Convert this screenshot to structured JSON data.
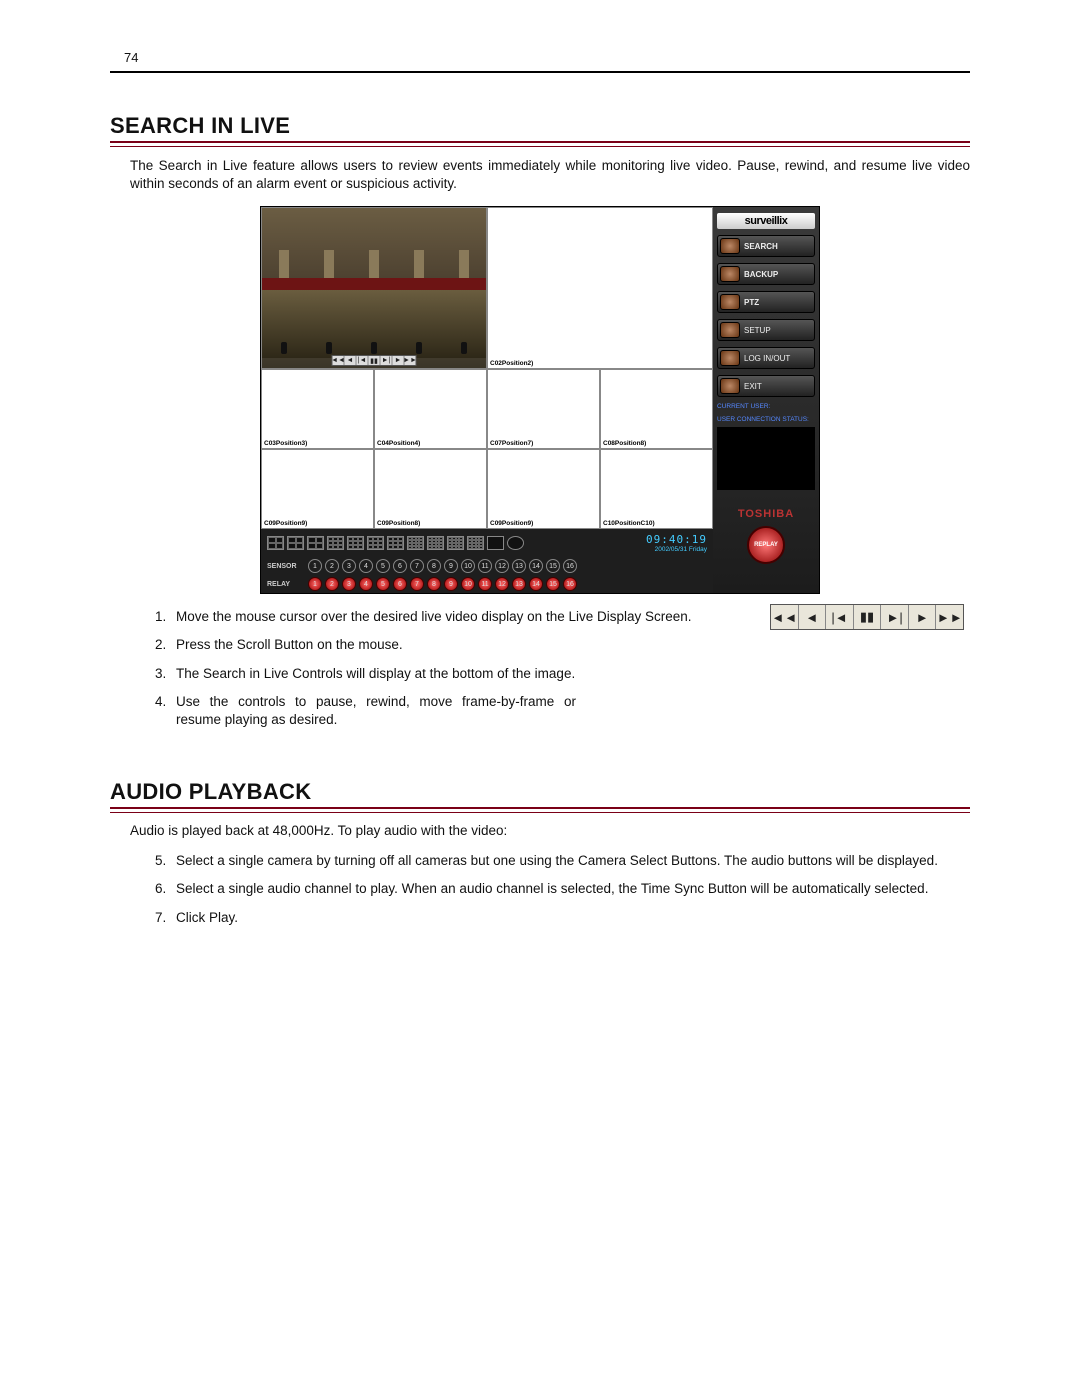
{
  "page_number": "74",
  "sections": {
    "search": {
      "title": "SEARCH IN LIVE",
      "lead": "The Search in Live feature allows users to review events immediately while monitoring live video.  Pause, rewind, and resume live video within seconds of an alarm event or suspicious activity.",
      "steps": [
        "Move the mouse cursor over the desired live video display on the Live Display Screen.",
        "Press the Scroll Button on the mouse.",
        "The Search in Live Controls will display at the bottom of the image.",
        "Use the controls to pause, rewind, move frame-by-frame or resume playing as desired."
      ]
    },
    "audio": {
      "title": "AUDIO PLAYBACK",
      "intro": "Audio is played back at 48,000Hz.  To play audio with the video:",
      "steps": [
        "Select a single camera by turning off all cameras but one using the Camera Select Buttons.  The audio buttons will be displayed.",
        "Select a single audio channel to play.  When an audio channel is selected, the Time Sync Button will be automatically selected.",
        "Click Play."
      ]
    }
  },
  "dvr": {
    "brand": "surveillix",
    "side_buttons": [
      "SEARCH",
      "BACKUP",
      "PTZ",
      "SETUP",
      "LOG IN/OUT",
      "EXIT"
    ],
    "status": {
      "user_label": "CURRENT USER:",
      "user_value": "",
      "conn_label": "USER CONNECTION STATUS:",
      "conn_value": ""
    },
    "toshiba": "TOSHIBA",
    "replay": "REPLAY",
    "cells": [
      "",
      "C02Position2)",
      "C03Position3)",
      "C04Position4)",
      "C07Position7)",
      "C08Position8)",
      "C09Position9)",
      "C09Position8)",
      "C09Position9)",
      "C10PositionC10)"
    ],
    "time": "09:40:19",
    "date": "2002/05/31  Friday",
    "sensor_label": "SENSOR",
    "relay_label": "RELAY"
  },
  "playback_bar_glyphs": [
    "◄◄",
    "◄",
    "|◄",
    "▮▮",
    "►|",
    "►",
    "►►"
  ],
  "controls_fig_glyphs": [
    "◄◄",
    "◄",
    "|◄",
    "▮▮",
    "►|",
    "►",
    "►►"
  ]
}
